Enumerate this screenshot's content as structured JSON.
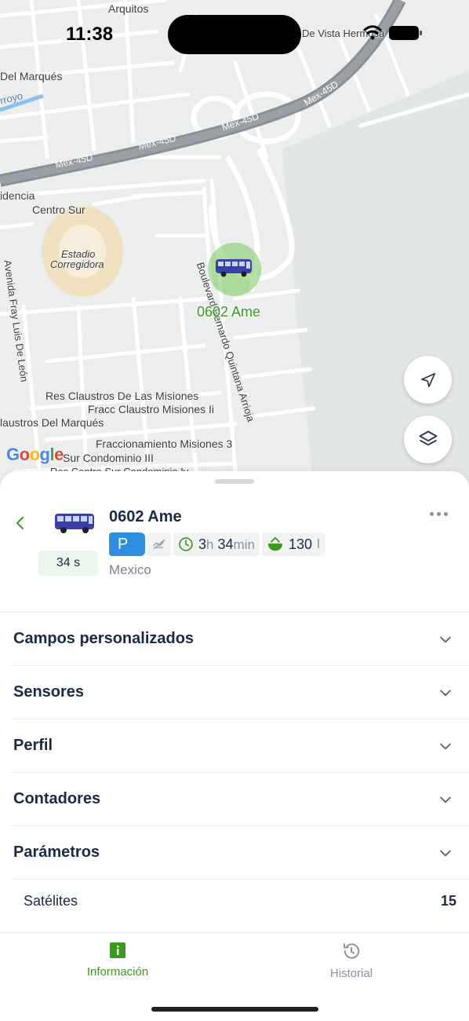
{
  "status_bar": {
    "time": "11:38"
  },
  "map": {
    "labels": {
      "arquitos": "Arquitos",
      "del_marques": "Del Marqués",
      "arroyo": "rroyo",
      "mex45d_1": "Mex-45D",
      "mex45d_2": "Mex-45D",
      "mex45d_3": "Mex-45D",
      "mex45d_4": "Mex-45D",
      "idencia": "idencia",
      "centro_sur": "Centro Sur",
      "estadio": "Estadio",
      "corregidora": "Corregidora",
      "de_vista": "De Vista Hermosa",
      "boulevard": "Boulevard Bernardo Quintana Arrioja",
      "avenida": "Avenida Fray Luis De León",
      "claustros_misiones": "Res Claustros De Las Misiones",
      "fracc_claustro": "Fracc Claustro Misiones Ii",
      "claustros_marques": "laustros Del Marqués",
      "fracc_misiones3": "Fraccionamiento Misiones 3",
      "centro_sur_condominio": "Sur Condominio III",
      "res_centro": "Res Centro Sur Condominio Iv"
    },
    "google_logo": "Google",
    "vehicle_label": "0602 Ame",
    "vehicle_color": "#3a9a1e"
  },
  "unit": {
    "name": "0602 Ame",
    "age": "34 s",
    "parking_badge": "P",
    "duration_hours": "3",
    "duration_h_unit": "h",
    "duration_minutes": "34",
    "duration_min_unit": "min",
    "fuel_value": "130",
    "fuel_unit": "l",
    "location": "Mexico"
  },
  "sections": [
    {
      "title": "Campos personalizados"
    },
    {
      "title": "Sensores"
    },
    {
      "title": "Perfil"
    },
    {
      "title": "Contadores"
    },
    {
      "title": "Parámetros"
    }
  ],
  "parameters": [
    {
      "name": "Satélites",
      "value": "15"
    }
  ],
  "bottom_nav": {
    "info_label": "Información",
    "history_label": "Historial"
  },
  "colors": {
    "accent_green": "#3a9a1e",
    "parking_blue": "#2d8ee0",
    "text_dark": "#1c2a44"
  }
}
